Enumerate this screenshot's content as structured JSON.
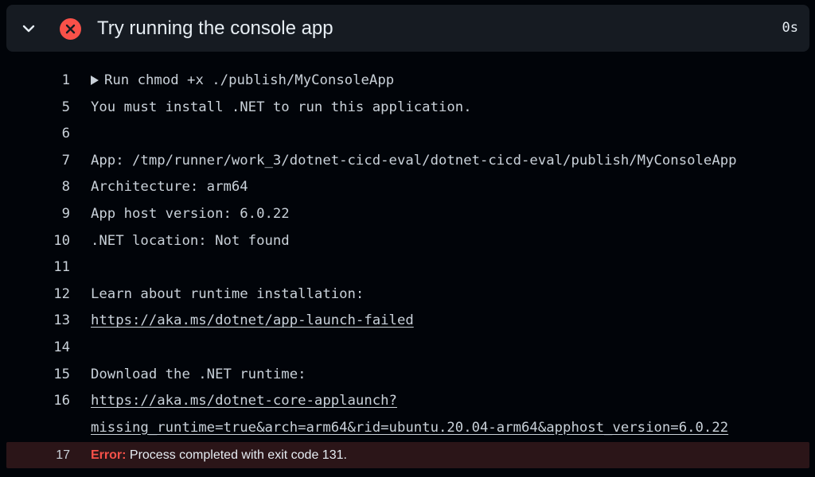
{
  "step": {
    "title": "Try running the console app",
    "duration": "0s",
    "status": "failed",
    "status_color": "#f85149",
    "chevron_icon": "chevron-down-icon",
    "status_icon": "x-circle-icon"
  },
  "log": {
    "lines": [
      {
        "number": "1",
        "text": "Run chmod +x ./publish/MyConsoleApp",
        "collapsible": true
      },
      {
        "number": "5",
        "text": "You must install .NET to run this application."
      },
      {
        "number": "6",
        "text": ""
      },
      {
        "number": "7",
        "text": "App: /tmp/runner/work_3/dotnet-cicd-eval/dotnet-cicd-eval/publish/MyConsoleApp"
      },
      {
        "number": "8",
        "text": "Architecture: arm64"
      },
      {
        "number": "9",
        "text": "App host version: 6.0.22"
      },
      {
        "number": "10",
        "text": ".NET location: Not found"
      },
      {
        "number": "11",
        "text": ""
      },
      {
        "number": "12",
        "text": "Learn about runtime installation:"
      },
      {
        "number": "13",
        "text": "https://aka.ms/dotnet/app-launch-failed",
        "link": true
      },
      {
        "number": "14",
        "text": ""
      },
      {
        "number": "15",
        "text": "Download the .NET runtime:"
      },
      {
        "number": "16",
        "text": "https://aka.ms/dotnet-core-applaunch?",
        "link": true
      },
      {
        "number": "",
        "text": "missing_runtime=true&arch=arm64&rid=ubuntu.20.04-arm64&apphost_version=6.0.22",
        "link": true
      }
    ],
    "error": {
      "number": "17",
      "label": "Error:",
      "message": " Process completed with exit code 131."
    }
  }
}
